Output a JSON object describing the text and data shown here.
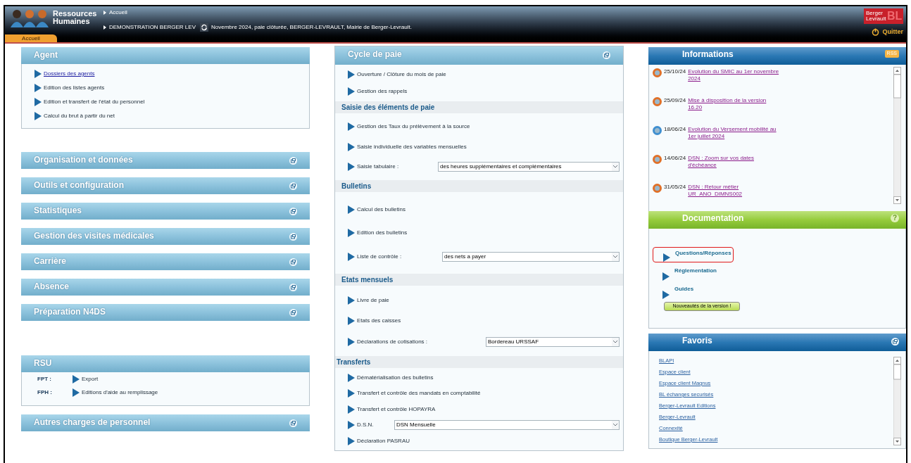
{
  "header": {
    "app_title": "Ressources Humaines",
    "breadcrumb": "Accueil",
    "context": "DEMONSTRATION BERGER LEV",
    "status": "Novembre 2024, paie clôturée, BERGER-LEVRAULT, Mairie de Berger-Levrault.",
    "logo": {
      "name": "Berger Levrault",
      "mark": "BL"
    },
    "quit": "Quitter"
  },
  "tabs": [
    {
      "label": "Accueil",
      "selected": true
    }
  ],
  "left_panels": [
    {
      "title": "Agent",
      "kind": "list",
      "expanded": true,
      "items": [
        {
          "label": "Dossiers des agents",
          "visited": true
        },
        {
          "label": "Edition des listes agents",
          "visited": false
        },
        {
          "label": "Edition et transfert de l'état du personnel",
          "visited": false
        },
        {
          "label": "Calcul du brut à partir du net",
          "visited": false
        }
      ]
    },
    {
      "title": "Organisation et données",
      "kind": "list",
      "expanded": false
    },
    {
      "title": "Outils et configuration",
      "kind": "list",
      "expanded": false
    },
    {
      "title": "Statistiques",
      "kind": "list",
      "expanded": false
    },
    {
      "title": "Gestion des visites médicales",
      "kind": "list",
      "expanded": false
    },
    {
      "title": "Carrière",
      "kind": "list",
      "expanded": false
    },
    {
      "title": "Absence",
      "kind": "list",
      "expanded": false
    },
    {
      "title": "Préparation N4DS",
      "kind": "list",
      "expanded": false
    },
    {
      "title": "RSU",
      "kind": "labelled",
      "expanded": true,
      "rows": [
        {
          "label": "FPT :",
          "item": "Export"
        },
        {
          "label": "FPH :",
          "item": "Editions d'aide au remplissage"
        }
      ]
    },
    {
      "title": "Autres charges de personnel",
      "kind": "list",
      "expanded": false
    }
  ],
  "payroll": {
    "title": "Cycle de paie",
    "sections": [
      {
        "items": [
          {
            "label": "Ouverture / Clôture du mois de paie"
          },
          {
            "label": "Gestion des rappels"
          }
        ]
      },
      {
        "heading": "Saisie des éléments de paie",
        "items": [
          {
            "label": "Gestion des Taux du prélèvement à la source"
          },
          {
            "label": "Saisie individuelle des variables mensuelles"
          },
          {
            "label": "Saisie tabulaire :",
            "select": "des heures supplémentaires et complémentaires"
          }
        ]
      },
      {
        "heading": "Bulletins",
        "items": [
          {
            "label": "Calcul des bulletins"
          },
          {
            "label": "Edition des bulletins"
          },
          {
            "label": "Liste de contrôle :",
            "select": "des nets a payer"
          }
        ]
      },
      {
        "heading": "Etats mensuels",
        "items": [
          {
            "label": "Livre de paie"
          },
          {
            "label": "Etats des caisses"
          },
          {
            "label": "Déclarations de cotisations :",
            "select": "Bordereau URSSAF"
          }
        ]
      },
      {
        "heading": "Transferts",
        "items": [
          {
            "label": "Dématérialisation des bulletins"
          },
          {
            "label": "Transfert et contrôle des mandats en comptabilité"
          },
          {
            "label": "Transfert et contrôle HOPAYRA"
          },
          {
            "label": "D.S.N.",
            "select": "DSN Mensuelle"
          },
          {
            "label": "Déclaration PASRAU"
          }
        ]
      }
    ]
  },
  "informations": {
    "title": "Informations",
    "badge": "RSS",
    "items": [
      {
        "date": "25/10/24",
        "title": "Evolution du SMIC au 1er novembre 2024",
        "color": "#e07028"
      },
      {
        "date": "25/09/24",
        "title": "Mise à disposition de la version 16.20",
        "color": "#e07028"
      },
      {
        "date": "18/06/24",
        "title": "Evolution du Versement mobilité au 1er juillet 2024",
        "color": "#3f8fd0"
      },
      {
        "date": "14/06/24",
        "title": "DSN : Zoom sur vos dates d'échéance",
        "color": "#e07028"
      },
      {
        "date": "31/05/24",
        "title": "DSN : Retour métier UR_ANO_DIMNS002",
        "color": "#e07028"
      }
    ]
  },
  "documentation": {
    "title": "Documentation",
    "help": "?",
    "items": [
      {
        "label": "Questions/Réponses",
        "highlighted": true
      },
      {
        "label": "Réglementation",
        "highlighted": false
      },
      {
        "label": "Guides",
        "highlighted": false
      }
    ],
    "button": "Nouveautés de la version !"
  },
  "favoris": {
    "title": "Favoris",
    "links": [
      "BLAPI",
      "Espace client",
      "Espace client Magnus",
      "BL échanges securisés",
      "Berger-Levrault Editions",
      "Berger-Levrault",
      "Connexité",
      "Boutique Berger-Levrault"
    ]
  }
}
